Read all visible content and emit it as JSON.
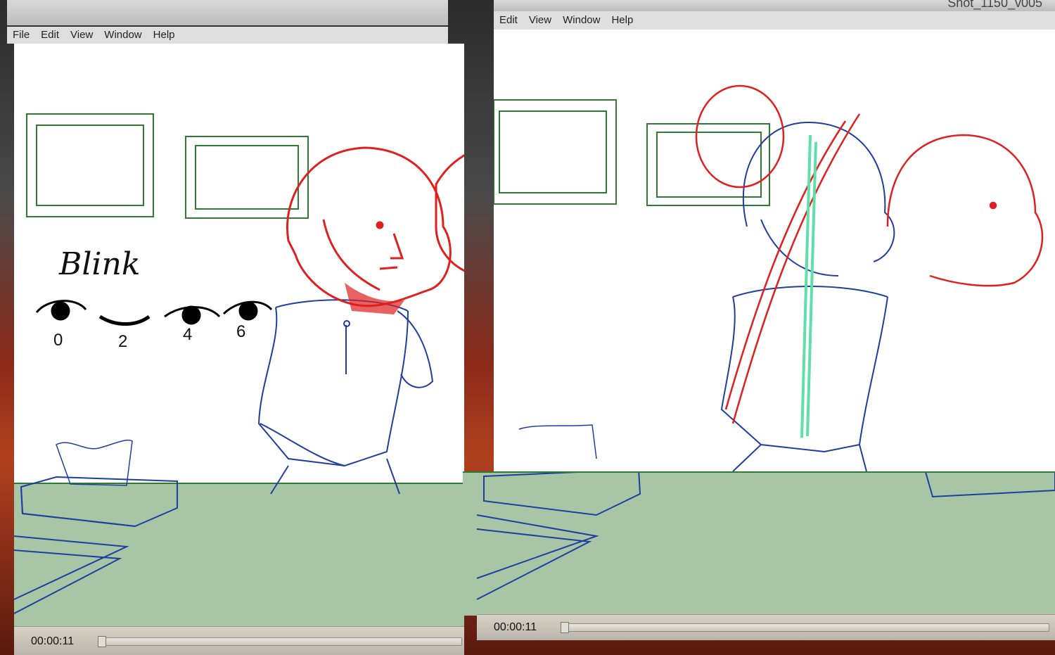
{
  "left_window": {
    "menu": [
      "File",
      "Edit",
      "View",
      "Window",
      "Help"
    ],
    "timecode": "00:00:11",
    "blink": {
      "title": "Blink",
      "frames": [
        "0",
        "2",
        "4",
        "6"
      ]
    }
  },
  "right_window": {
    "title": "Shot_1150_v005",
    "menu": [
      "Edit",
      "View",
      "Window",
      "Help"
    ],
    "timecode": "00:00:11"
  },
  "colors": {
    "sketch_blue": "#1f3fa0",
    "sketch_red": "#e02020",
    "guide_green": "#2e7d32",
    "table_fill": "#a8c6a6",
    "highlight_mint": "#5fe0a8"
  }
}
